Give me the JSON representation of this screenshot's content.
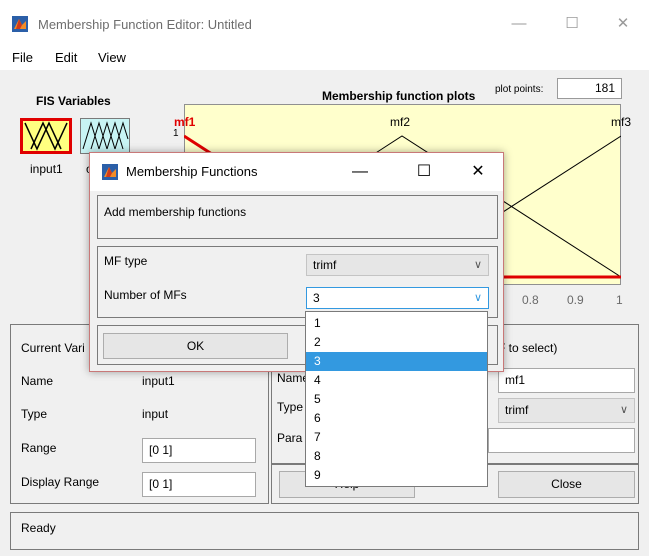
{
  "main_window": {
    "title": "Membership Function Editor: Untitled",
    "controls": {
      "minimize": "—",
      "maximize": "☐",
      "close": "✕"
    },
    "app_icon": "matlab-icon"
  },
  "menu": {
    "items": [
      "File",
      "Edit",
      "View"
    ]
  },
  "fis_variables": {
    "heading": "FIS Variables",
    "input_label": "input1",
    "output_label_partial": "o"
  },
  "plot": {
    "title": "Membership function plots",
    "points_label": "plot points:",
    "points_value": "181",
    "mf_labels": [
      "mf1",
      "mf2",
      "mf3"
    ],
    "visible_ticks": [
      "0.8",
      "0.9",
      "1"
    ],
    "y_tick_partial": "1",
    "background_color": "#ffffcc",
    "selected_color": "#e00000"
  },
  "current_variable": {
    "heading_partial": "Current Vari",
    "name_label": "Name",
    "name_value": "input1",
    "type_label": "Type",
    "type_value": "input",
    "range_label": "Range",
    "range_value": "[0 1]",
    "display_range_label": "Display Range",
    "display_range_value": "[0 1]"
  },
  "current_mf": {
    "heading_partial": "F to select)",
    "name_label_partial": "Name",
    "type_label_partial": "Type",
    "params_label_partial": "Para",
    "name_value": "mf1",
    "type_value": "trimf",
    "params_value": ""
  },
  "buttons": {
    "help_partial": "Help",
    "close": "Close"
  },
  "status": {
    "text": "Ready"
  },
  "dialog": {
    "title": "Membership Functions",
    "controls": {
      "minimize": "—",
      "maximize": "☐",
      "close": "✕"
    },
    "add_text": "Add membership functions",
    "mf_type_label": "MF type",
    "mf_type_value": "trimf",
    "number_label": "Number of MFs",
    "number_value": "3",
    "ok_label": "OK"
  },
  "dropdown": {
    "options": [
      "1",
      "2",
      "3",
      "4",
      "5",
      "6",
      "7",
      "8",
      "9"
    ],
    "selected": "3",
    "highlight_color": "#3399e0"
  }
}
